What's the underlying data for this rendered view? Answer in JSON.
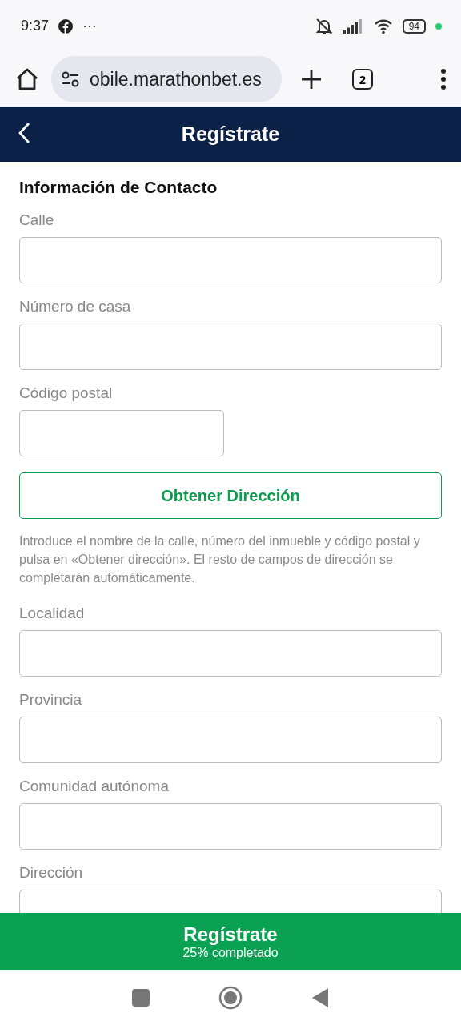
{
  "status_bar": {
    "time": "9:37",
    "more": "···",
    "battery": "94"
  },
  "browser": {
    "url": "obile.marathonbet.es",
    "tab_count": "2"
  },
  "header": {
    "title": "Regístrate"
  },
  "section_title": "Información de Contacto",
  "fields_top": [
    {
      "label": "Calle",
      "wide": true
    },
    {
      "label": "Número de casa",
      "wide": true
    },
    {
      "label": "Código postal",
      "wide": false
    }
  ],
  "lookup_button": "Obtener Dirección",
  "hint": "Introduce el nombre de la calle, número del inmueble y código postal y pulsa en «Obtener dirección». El resto de campos de dirección se completarán automáticamente.",
  "fields_bottom": [
    {
      "label": "Localidad",
      "wide": true
    },
    {
      "label": "Provincia",
      "wide": true
    },
    {
      "label": "Comunidad autónoma",
      "wide": true
    },
    {
      "label": "Dirección",
      "wide": true
    }
  ],
  "footer": {
    "button": "Regístrate",
    "progress": "25% completado"
  }
}
